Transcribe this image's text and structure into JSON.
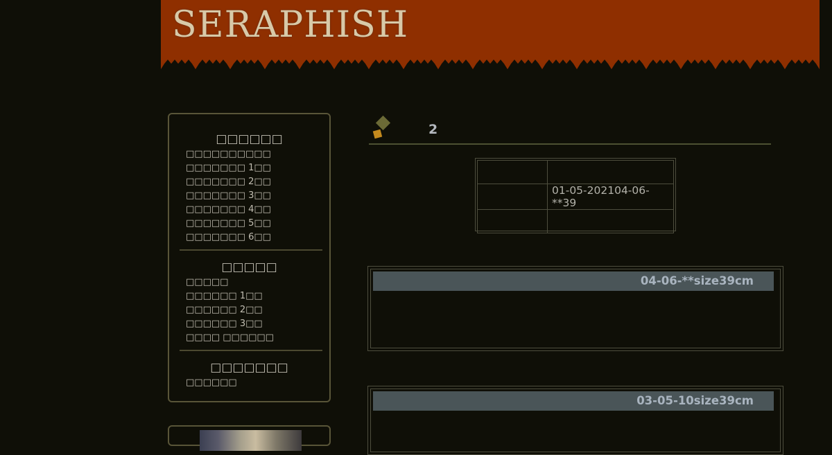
{
  "header": {
    "logo_text": "SERAPHISH"
  },
  "sidebar": {
    "sections": [
      {
        "title": "□□□□□□",
        "items": [
          "□□□□□□□□□□",
          "□□□□□□□ 1□□",
          "□□□□□□□ 2□□",
          "□□□□□□□ 3□□",
          "□□□□□□□ 4□□",
          "□□□□□□□ 5□□",
          "□□□□□□□ 6□□"
        ]
      },
      {
        "title": "□□□□□",
        "items": [
          "□□□□□",
          "□□□□□□ 1□□",
          "□□□□□□ 2□□",
          "□□□□□□ 3□□",
          "□□□□ □□□□□□"
        ]
      },
      {
        "title": "□□□□□□□",
        "items": [
          "□□□□□□"
        ]
      }
    ]
  },
  "content": {
    "page_number": "2",
    "info_table": {
      "rows": [
        [
          "",
          ""
        ],
        [
          "",
          "01-05-202104-06-**39"
        ],
        [
          "",
          ""
        ]
      ]
    },
    "posts": [
      {
        "title": "04-06-**size39cm"
      },
      {
        "title": "03-05-10size39cm"
      }
    ]
  },
  "colors": {
    "header_bg": "#8f2f00",
    "page_bg": "#0f0f07",
    "post_bar_bg": "#4a5558",
    "accent": "#c48a1e"
  }
}
